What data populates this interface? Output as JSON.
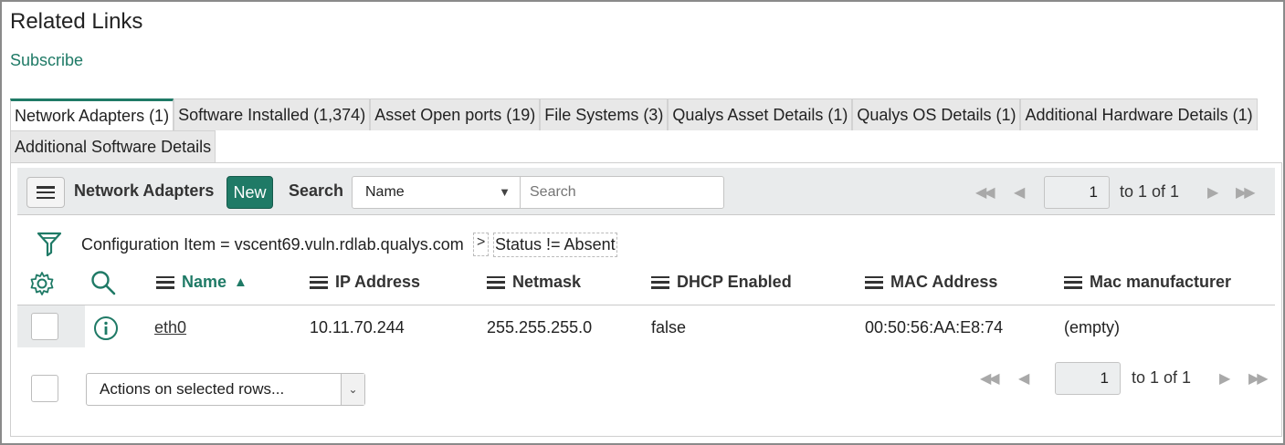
{
  "section": {
    "title": "Related Links",
    "subscribe_label": "Subscribe"
  },
  "tabs": [
    {
      "label": "Network Adapters (1)",
      "active": true
    },
    {
      "label": "Software Installed (1,374)"
    },
    {
      "label": "Asset Open ports (19)"
    },
    {
      "label": "File Systems (3)"
    },
    {
      "label": "Qualys Asset Details (1)"
    },
    {
      "label": "Qualys OS Details (1)"
    },
    {
      "label": "Additional Hardware Details (1)"
    },
    {
      "label": "Additional Software Details"
    }
  ],
  "toolbar": {
    "title": "Network Adapters",
    "new_label": "New",
    "search_label": "Search",
    "search_field": "Name",
    "search_placeholder": "Search",
    "page": "1",
    "page_of": "to 1 of 1"
  },
  "breadcrumb": {
    "part1": "Configuration Item = vscent69.vuln.rdlab.qualys.com",
    "sep": ">",
    "part2": "Status != Absent"
  },
  "columns": {
    "name": "Name",
    "ip": "IP Address",
    "netmask": "Netmask",
    "dhcp": "DHCP Enabled",
    "mac": "MAC Address",
    "manufacturer": "Mac manufacturer"
  },
  "rows": [
    {
      "name": "eth0",
      "ip": "10.11.70.244",
      "netmask": "255.255.255.0",
      "dhcp": "false",
      "mac": "00:50:56:AA:E8:74",
      "manufacturer": "(empty)"
    }
  ],
  "footer": {
    "actions_label": "Actions on selected rows...",
    "page": "1",
    "page_of": "to 1 of 1"
  },
  "colors": {
    "accent": "#1f7a66",
    "toolbar_bg": "#e9ebec"
  }
}
